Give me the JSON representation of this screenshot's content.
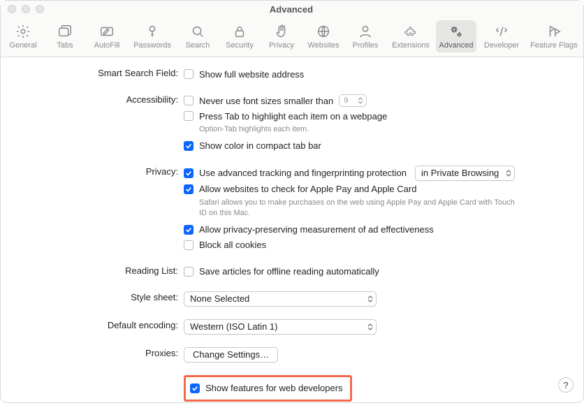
{
  "window": {
    "title": "Advanced"
  },
  "toolbar": {
    "items": [
      {
        "key": "general",
        "label": "General"
      },
      {
        "key": "tabs",
        "label": "Tabs"
      },
      {
        "key": "autofill",
        "label": "AutoFill"
      },
      {
        "key": "passwords",
        "label": "Passwords"
      },
      {
        "key": "search",
        "label": "Search"
      },
      {
        "key": "security",
        "label": "Security"
      },
      {
        "key": "privacy",
        "label": "Privacy"
      },
      {
        "key": "websites",
        "label": "Websites"
      },
      {
        "key": "profiles",
        "label": "Profiles"
      },
      {
        "key": "extensions",
        "label": "Extensions"
      },
      {
        "key": "advanced",
        "label": "Advanced"
      },
      {
        "key": "developer",
        "label": "Developer"
      },
      {
        "key": "featureflags",
        "label": "Feature Flags"
      }
    ],
    "active": "advanced"
  },
  "sections": {
    "smart_search": {
      "label": "Smart Search Field:",
      "show_full_address": {
        "label": "Show full website address",
        "checked": false
      }
    },
    "accessibility": {
      "label": "Accessibility:",
      "never_use_font": {
        "label": "Never use font sizes smaller than",
        "checked": false,
        "value": "9"
      },
      "press_tab": {
        "label": "Press Tab to highlight each item on a webpage",
        "checked": false,
        "hint": "Option-Tab highlights each item."
      },
      "show_color": {
        "label": "Show color in compact tab bar",
        "checked": true
      }
    },
    "privacy": {
      "label": "Privacy:",
      "advanced_tracking": {
        "label": "Use advanced tracking and fingerprinting protection",
        "checked": true,
        "dropdown": "in Private Browsing"
      },
      "apple_pay": {
        "label": "Allow websites to check for Apple Pay and Apple Card",
        "checked": true,
        "hint": "Safari allows you to make purchases on the web using Apple Pay and Apple Card with Touch ID on this Mac."
      },
      "ad_measure": {
        "label": "Allow privacy-preserving measurement of ad effectiveness",
        "checked": true
      },
      "block_cookies": {
        "label": "Block all cookies",
        "checked": false
      }
    },
    "reading_list": {
      "label": "Reading List:",
      "save_offline": {
        "label": "Save articles for offline reading automatically",
        "checked": false
      }
    },
    "style_sheet": {
      "label": "Style sheet:",
      "value": "None Selected"
    },
    "default_encoding": {
      "label": "Default encoding:",
      "value": "Western (ISO Latin 1)"
    },
    "proxies": {
      "label": "Proxies:",
      "button": "Change Settings…"
    },
    "developers": {
      "label": "Show features for web developers",
      "checked": true
    }
  },
  "help": "?"
}
